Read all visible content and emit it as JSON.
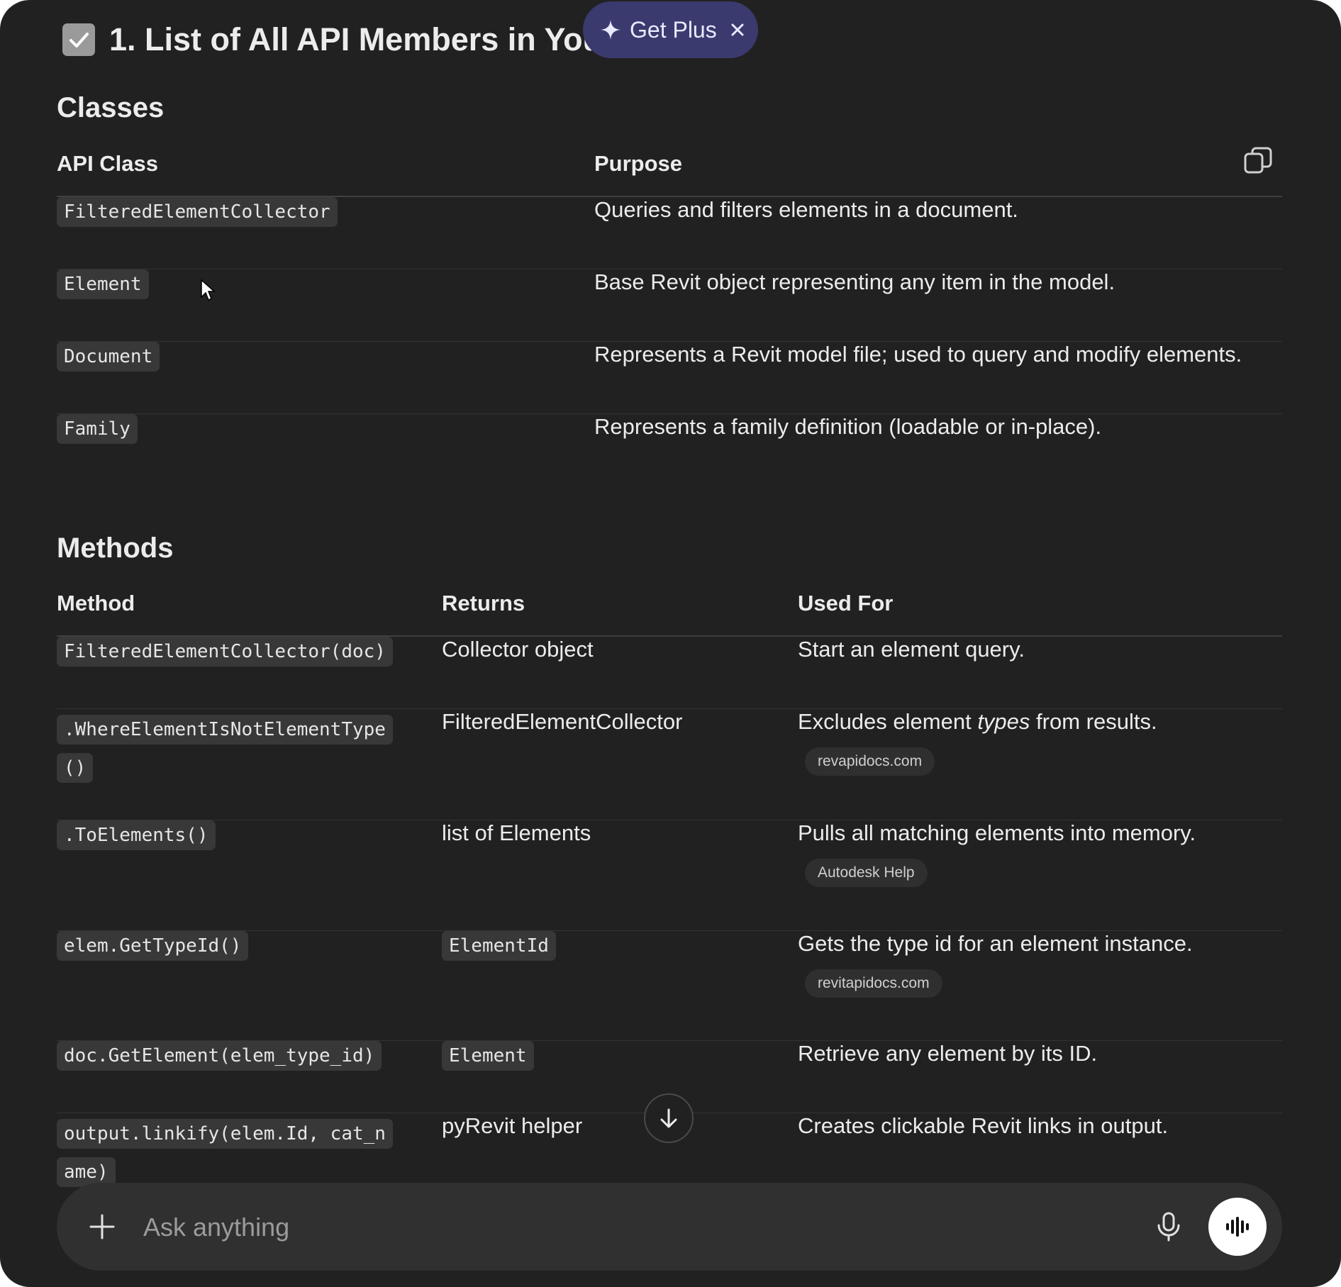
{
  "heading": {
    "title": "1. List of All API Members in Your"
  },
  "get_plus": {
    "label": "Get Plus",
    "close": "×"
  },
  "classes_section": {
    "title": "Classes",
    "headers": [
      "API Class",
      "Purpose"
    ],
    "rows": [
      {
        "api_class": "FilteredElementCollector",
        "purpose": "Queries and filters elements in a document."
      },
      {
        "api_class": "Element",
        "purpose": "Base Revit object representing any item in the model."
      },
      {
        "api_class": "Document",
        "purpose": "Represents a Revit model file; used to query and modify elements."
      },
      {
        "api_class": "Family",
        "purpose": "Represents a family definition (loadable or in-place)."
      }
    ]
  },
  "methods_section": {
    "title": "Methods",
    "headers": [
      "Method",
      "Returns",
      "Used For"
    ],
    "rows": [
      {
        "method": "FilteredElementCollector(doc)",
        "returns": "Collector object",
        "returns_is_code": false,
        "used_for": "Start an element query.",
        "source": ""
      },
      {
        "method": ".WhereElementIsNotElementType()",
        "returns": "FilteredElementCollector",
        "returns_is_code": false,
        "used_for_pre": "Excludes element ",
        "used_for_em": "types",
        "used_for_post": " from results.",
        "source": "revapidocs.com"
      },
      {
        "method": ".ToElements()",
        "returns": "list of Elements",
        "returns_is_code": false,
        "used_for": "Pulls all matching elements into memory.",
        "source": "Autodesk Help"
      },
      {
        "method": "elem.GetTypeId()",
        "returns": "ElementId",
        "returns_is_code": true,
        "used_for": "Gets the type id for an element instance.",
        "source": "revitapidocs.com"
      },
      {
        "method": "doc.GetElement(elem_type_id)",
        "returns": "Element",
        "returns_is_code": true,
        "used_for": "Retrieve any element by its ID.",
        "source": ""
      },
      {
        "method": "output.linkify(elem.Id, cat_name)",
        "returns": "pyRevit helper",
        "returns_is_code": false,
        "used_for": "Creates clickable Revit links in output.",
        "source": ""
      }
    ]
  },
  "composer": {
    "placeholder": "Ask anything"
  },
  "icons": {
    "checkbox": "checkbox-checked-icon",
    "sparkle": "sparkle-icon",
    "close": "close-icon",
    "copy": "copy-icon",
    "scroll": "arrow-down-icon",
    "plus": "plus-icon",
    "mic": "microphone-icon",
    "voice": "voice-mode-icon"
  }
}
